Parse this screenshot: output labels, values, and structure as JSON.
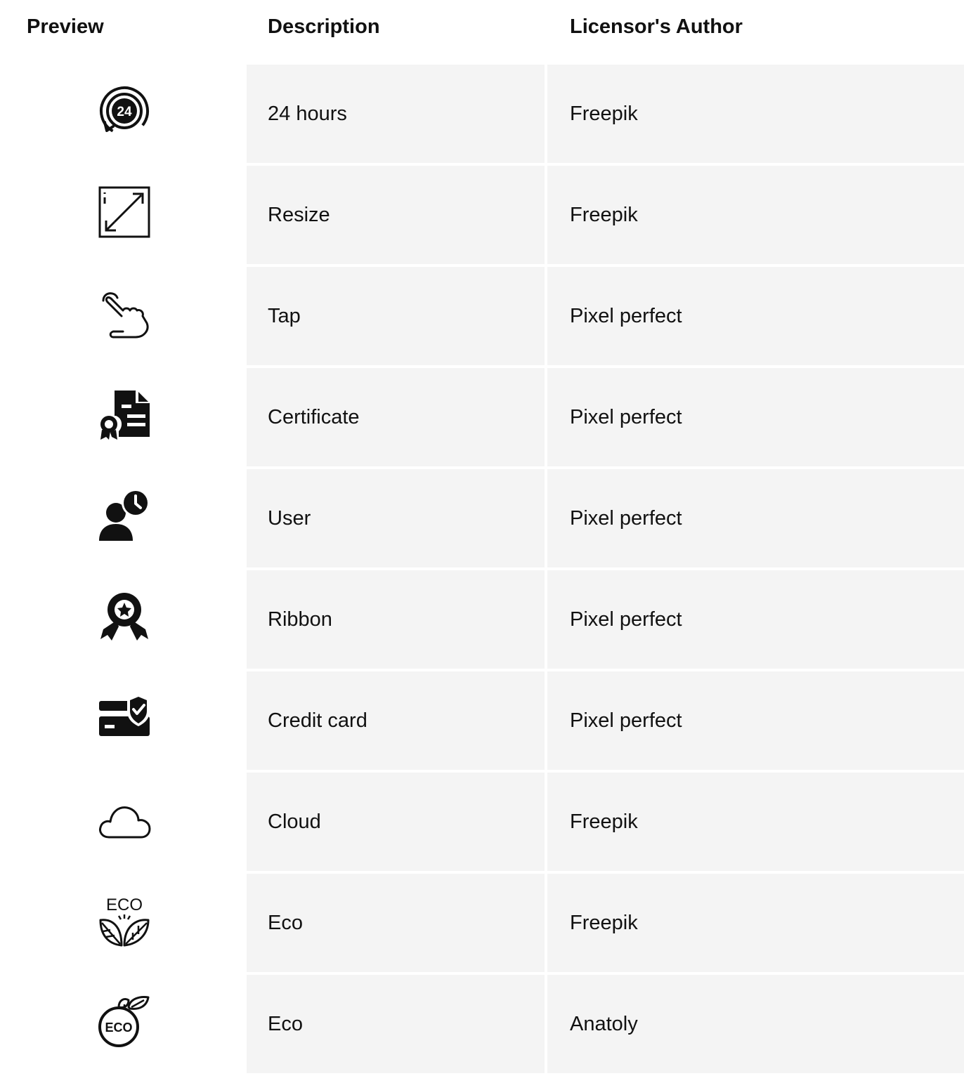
{
  "table": {
    "headers": {
      "preview": "Preview",
      "description": "Description",
      "author": "Licensor's Author"
    },
    "rows": [
      {
        "icon": "24-hours-icon",
        "description": "24 hours",
        "author": "Freepik"
      },
      {
        "icon": "resize-icon",
        "description": "Resize",
        "author": "Freepik"
      },
      {
        "icon": "tap-icon",
        "description": "Tap",
        "author": "Pixel perfect"
      },
      {
        "icon": "certificate-icon",
        "description": "Certificate",
        "author": "Pixel perfect"
      },
      {
        "icon": "user-clock-icon",
        "description": "User",
        "author": "Pixel perfect"
      },
      {
        "icon": "ribbon-icon",
        "description": "Ribbon",
        "author": "Pixel perfect"
      },
      {
        "icon": "credit-card-shield-icon",
        "description": "Credit card",
        "author": "Pixel perfect"
      },
      {
        "icon": "cloud-icon",
        "description": "Cloud",
        "author": "Freepik"
      },
      {
        "icon": "eco-leaves-icon",
        "description": "Eco",
        "author": "Freepik"
      },
      {
        "icon": "eco-badge-icon",
        "description": "Eco",
        "author": "Anatoly"
      }
    ]
  },
  "icon_texts": {
    "hours": "24",
    "eco": "ECO"
  }
}
